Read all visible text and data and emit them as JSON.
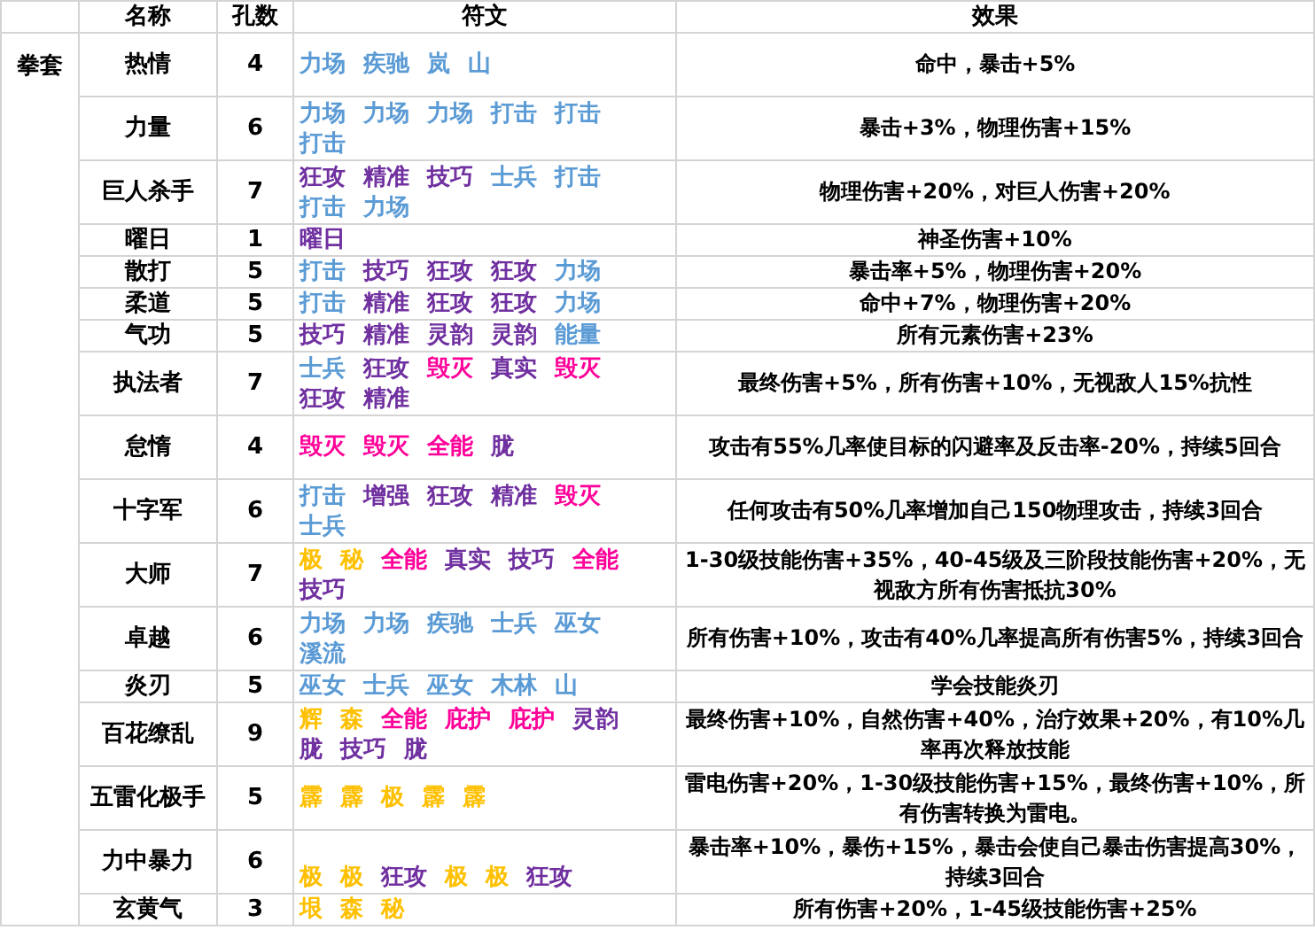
{
  "columns": [
    "名称",
    "孔数",
    "符文",
    "效果"
  ],
  "category": "拳套",
  "rows": [
    {
      "name": "热情",
      "holes": "4",
      "runes": [
        {
          "text": "力场",
          "color": "#5b9bd5"
        },
        {
          "text": "疾驰",
          "color": "#5b9bd5"
        },
        {
          "text": "岚",
          "color": "#5b9bd5"
        },
        {
          "text": "山",
          "color": "#5b9bd5"
        }
      ],
      "effect": "命中，暴击+5%"
    },
    {
      "name": "力量",
      "holes": "6",
      "runes": [
        {
          "text": "力场",
          "color": "#5b9bd5"
        },
        {
          "text": "力场",
          "color": "#5b9bd5"
        },
        {
          "text": "力场",
          "color": "#5b9bd5"
        },
        {
          "text": "打击",
          "color": "#5b9bd5"
        },
        {
          "text": "打击",
          "color": "#5b9bd5"
        },
        {
          "text": "打击",
          "color": "#5b9bd5"
        }
      ],
      "effect": "暴击+3%，物理伤害+15%"
    },
    {
      "name": "巨人杀手",
      "holes": "7",
      "runes": [
        {
          "text": "狂攻",
          "color": "#7030a0"
        },
        {
          "text": "精准",
          "color": "#7030a0"
        },
        {
          "text": "技巧",
          "color": "#7030a0"
        },
        {
          "text": "士兵",
          "color": "#5b9bd5"
        },
        {
          "text": "打击",
          "color": "#5b9bd5"
        },
        {
          "text": "打击",
          "color": "#5b9bd5"
        },
        {
          "text": "力场",
          "color": "#5b9bd5"
        }
      ],
      "effect": "物理伤害+20%，对巨人伤害+20%"
    },
    {
      "name": "曜日",
      "holes": "1",
      "runes": [
        {
          "text": "曜日",
          "color": "#7030a0"
        }
      ],
      "effect": "神圣伤害+10%"
    },
    {
      "name": "散打",
      "holes": "5",
      "runes": [
        {
          "text": "打击",
          "color": "#5b9bd5"
        },
        {
          "text": "技巧",
          "color": "#7030a0"
        },
        {
          "text": "狂攻",
          "color": "#7030a0"
        },
        {
          "text": "狂攻",
          "color": "#7030a0"
        },
        {
          "text": "力场",
          "color": "#5b9bd5"
        }
      ],
      "effect": "暴击率+5%，物理伤害+20%"
    },
    {
      "name": "柔道",
      "holes": "5",
      "runes": [
        {
          "text": "打击",
          "color": "#5b9bd5"
        },
        {
          "text": "精准",
          "color": "#7030a0"
        },
        {
          "text": "狂攻",
          "color": "#7030a0"
        },
        {
          "text": "狂攻",
          "color": "#7030a0"
        },
        {
          "text": "力场",
          "color": "#5b9bd5"
        }
      ],
      "effect": "命中+7%，物理伤害+20%"
    },
    {
      "name": "气功",
      "holes": "5",
      "runes": [
        {
          "text": "技巧",
          "color": "#7030a0"
        },
        {
          "text": "精准",
          "color": "#7030a0"
        },
        {
          "text": "灵韵",
          "color": "#7030a0"
        },
        {
          "text": "灵韵",
          "color": "#7030a0"
        },
        {
          "text": "能量",
          "color": "#5b9bd5"
        }
      ],
      "effect": "所有元素伤害+23%"
    },
    {
      "name": "执法者",
      "holes": "7",
      "runes": [
        {
          "text": "士兵",
          "color": "#5b9bd5"
        },
        {
          "text": "狂攻",
          "color": "#7030a0"
        },
        {
          "text": "毁灭",
          "color": "#ff0099"
        },
        {
          "text": "真实",
          "color": "#7030a0"
        },
        {
          "text": "毁灭",
          "color": "#ff0099"
        },
        {
          "text": "狂攻",
          "color": "#7030a0"
        },
        {
          "text": "精准",
          "color": "#7030a0"
        }
      ],
      "effect": "最终伤害+5%，所有伤害+10%，无视敌人15%抗性"
    },
    {
      "name": "怠惰",
      "holes": "4",
      "runes": [
        {
          "text": "毁灭",
          "color": "#ff0099"
        },
        {
          "text": "毁灭",
          "color": "#ff0099"
        },
        {
          "text": "全能",
          "color": "#ff0099"
        },
        {
          "text": "胧",
          "color": "#7030a0"
        }
      ],
      "effect": "攻击有55%几率使目标的闪避率及反击率-20%，持续5回合"
    },
    {
      "name": "十字军",
      "holes": "6",
      "runes": [
        {
          "text": "打击",
          "color": "#5b9bd5"
        },
        {
          "text": "增强",
          "color": "#7030a0"
        },
        {
          "text": "狂攻",
          "color": "#7030a0"
        },
        {
          "text": "精准",
          "color": "#7030a0"
        },
        {
          "text": "毁灭",
          "color": "#ff0099"
        },
        {
          "text": "士兵",
          "color": "#5b9bd5"
        }
      ],
      "effect": "任何攻击有50%几率增加自己150物理攻击，持续3回合"
    },
    {
      "name": "大师",
      "holes": "7",
      "runes": [
        {
          "text": "极",
          "color": "#ffc000"
        },
        {
          "text": "秘",
          "color": "#ffc000"
        },
        {
          "text": "全能",
          "color": "#ff0099"
        },
        {
          "text": "真实",
          "color": "#7030a0"
        },
        {
          "text": "技巧",
          "color": "#7030a0"
        },
        {
          "text": "全能",
          "color": "#ff0099"
        },
        {
          "text": "技巧",
          "color": "#7030a0"
        }
      ],
      "effect": "1-30级技能伤害+35%，40-45级及三阶段技能伤害+20%，无视敌方所有伤害抵抗30%"
    },
    {
      "name": "卓越",
      "holes": "6",
      "runes": [
        {
          "text": "力场",
          "color": "#5b9bd5"
        },
        {
          "text": "力场",
          "color": "#5b9bd5"
        },
        {
          "text": "疾驰",
          "color": "#5b9bd5"
        },
        {
          "text": "士兵",
          "color": "#5b9bd5"
        },
        {
          "text": "巫女",
          "color": "#5b9bd5"
        },
        {
          "text": "溪流",
          "color": "#5b9bd5"
        }
      ],
      "effect": "所有伤害+10%，攻击有40%几率提高所有伤害5%，持续3回合"
    },
    {
      "name": "炎刃",
      "holes": "5",
      "runes": [
        {
          "text": "巫女",
          "color": "#5b9bd5"
        },
        {
          "text": "士兵",
          "color": "#5b9bd5"
        },
        {
          "text": "巫女",
          "color": "#5b9bd5"
        },
        {
          "text": "木林",
          "color": "#5b9bd5"
        },
        {
          "text": "山",
          "color": "#5b9bd5"
        }
      ],
      "effect": "学会技能炎刃"
    },
    {
      "name": "百花缭乱",
      "holes": "9",
      "runes": [
        {
          "text": "辉",
          "color": "#ffc000"
        },
        {
          "text": "森",
          "color": "#ffc000"
        },
        {
          "text": "全能",
          "color": "#ff0099"
        },
        {
          "text": "庇护",
          "color": "#ff0099"
        },
        {
          "text": "庇护",
          "color": "#ff0099"
        },
        {
          "text": "灵韵",
          "color": "#7030a0"
        },
        {
          "text": "胧",
          "color": "#7030a0"
        },
        {
          "text": "技巧",
          "color": "#7030a0"
        },
        {
          "text": "胧",
          "color": "#7030a0"
        }
      ],
      "effect": "最终伤害+10%，自然伤害+40%，治疗效果+20%，有10%几率再次释放技能"
    },
    {
      "name": "五雷化极手",
      "holes": "5",
      "runes": [
        {
          "text": "霹",
          "color": "#ffc000"
        },
        {
          "text": "霹",
          "color": "#ffc000"
        },
        {
          "text": "极",
          "color": "#ffc000"
        },
        {
          "text": "霹",
          "color": "#ffc000"
        },
        {
          "text": "霹",
          "color": "#ffc000"
        }
      ],
      "effect": "雷电伤害+20%，1-30级技能伤害+15%，最终伤害+10%，所有伤害转换为雷电。"
    },
    {
      "name": "力中暴力",
      "holes": "6",
      "runes": [
        {
          "text": "极",
          "color": "#ffc000"
        },
        {
          "text": "极",
          "color": "#ffc000"
        },
        {
          "text": "狂攻",
          "color": "#7030a0"
        },
        {
          "text": "极",
          "color": "#ffc000"
        },
        {
          "text": "极",
          "color": "#ffc000"
        },
        {
          "text": "狂攻",
          "color": "#7030a0"
        }
      ],
      "effect": "暴击率+10%，暴伤+15%，暴击会使自己暴击伤害提高30%，持续3回合"
    },
    {
      "name": "玄黄气",
      "holes": "3",
      "runes": [
        {
          "text": "垠",
          "color": "#ffc000"
        },
        {
          "text": "森",
          "color": "#ffc000"
        },
        {
          "text": "秘",
          "color": "#ffc000"
        }
      ],
      "effect": "所有伤害+20%，1-45级技能伤害+25%"
    }
  ]
}
